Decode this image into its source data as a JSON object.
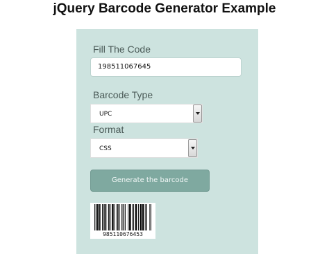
{
  "page": {
    "title": "jQuery Barcode Generator Example"
  },
  "form": {
    "code_label": "Fill The Code",
    "code_value": "198511067645",
    "type_label": "Barcode Type",
    "type_selected": "UPC",
    "format_label": "Format",
    "format_selected": "CSS",
    "generate_label": "Generate the barcode"
  },
  "barcode": {
    "digits": "985110676453",
    "pattern": "10101110110001101011000110100111010001101100010101010000101110010100111001001110111001010000101"
  },
  "colors": {
    "panel": "#cde3df",
    "button": "#7fa9a0"
  }
}
